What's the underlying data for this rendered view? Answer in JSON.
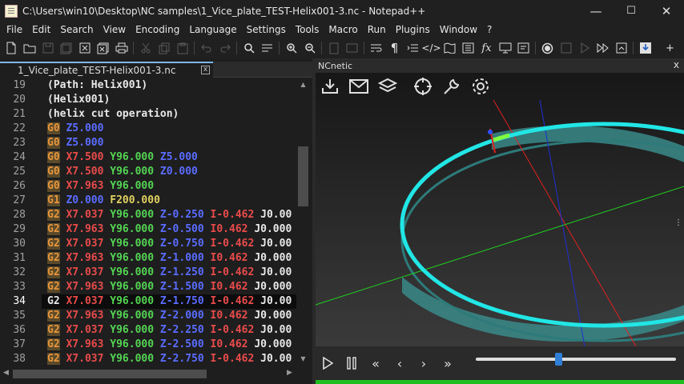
{
  "window": {
    "title": "C:\\Users\\win10\\Desktop\\NC samples\\1_Vice_plate_TEST-Helix001-3.nc - Notepad++",
    "minimize": "—",
    "maximize": "☐",
    "close": "✕"
  },
  "menu": [
    "File",
    "Edit",
    "Search",
    "View",
    "Encoding",
    "Language",
    "Settings",
    "Tools",
    "Macro",
    "Run",
    "Plugins",
    "Window",
    "?"
  ],
  "toolbar_more": "+",
  "editor": {
    "tab_label": "1_Vice_plate_TEST-Helix001-3.nc",
    "tab_close": "x",
    "current_line": 34,
    "lines": [
      {
        "n": "19",
        "tokens": [
          {
            "t": "(Path: Helix001)",
            "c": "c-cmt"
          }
        ]
      },
      {
        "n": "20",
        "tokens": [
          {
            "t": "(Helix001)",
            "c": "c-cmt"
          }
        ]
      },
      {
        "n": "21",
        "tokens": [
          {
            "t": "(helix cut operation)",
            "c": "c-cmt"
          }
        ]
      },
      {
        "n": "22",
        "tokens": [
          {
            "t": "G0",
            "c": "c-g"
          },
          {
            "t": " "
          },
          {
            "t": "Z5.000",
            "c": "c-z"
          }
        ]
      },
      {
        "n": "23",
        "tokens": [
          {
            "t": "G0",
            "c": "c-g"
          },
          {
            "t": " "
          },
          {
            "t": "Z5.000",
            "c": "c-z"
          }
        ]
      },
      {
        "n": "24",
        "tokens": [
          {
            "t": "G0",
            "c": "c-g"
          },
          {
            "t": " "
          },
          {
            "t": "X7.500",
            "c": "c-x"
          },
          {
            "t": " "
          },
          {
            "t": "Y96.000",
            "c": "c-y"
          },
          {
            "t": " "
          },
          {
            "t": "Z5.000",
            "c": "c-z"
          }
        ]
      },
      {
        "n": "25",
        "tokens": [
          {
            "t": "G0",
            "c": "c-g"
          },
          {
            "t": " "
          },
          {
            "t": "X7.500",
            "c": "c-x"
          },
          {
            "t": " "
          },
          {
            "t": "Y96.000",
            "c": "c-y"
          },
          {
            "t": " "
          },
          {
            "t": "Z0.000",
            "c": "c-z"
          }
        ]
      },
      {
        "n": "26",
        "tokens": [
          {
            "t": "G0",
            "c": "c-g"
          },
          {
            "t": " "
          },
          {
            "t": "X7.963",
            "c": "c-x"
          },
          {
            "t": " "
          },
          {
            "t": "Y96.000",
            "c": "c-y"
          }
        ]
      },
      {
        "n": "27",
        "tokens": [
          {
            "t": "G1",
            "c": "c-g"
          },
          {
            "t": " "
          },
          {
            "t": "Z0.000",
            "c": "c-z"
          },
          {
            "t": " "
          },
          {
            "t": "F200.000",
            "c": "c-f"
          }
        ]
      },
      {
        "n": "28",
        "tokens": [
          {
            "t": "G2",
            "c": "c-g"
          },
          {
            "t": " "
          },
          {
            "t": "X7.037",
            "c": "c-x"
          },
          {
            "t": " "
          },
          {
            "t": "Y96.000",
            "c": "c-y"
          },
          {
            "t": " "
          },
          {
            "t": "Z-0.250",
            "c": "c-z"
          },
          {
            "t": " "
          },
          {
            "t": "I-0.462",
            "c": "c-i"
          },
          {
            "t": " "
          },
          {
            "t": "J0.00",
            "c": "c-j"
          }
        ]
      },
      {
        "n": "29",
        "tokens": [
          {
            "t": "G2",
            "c": "c-g"
          },
          {
            "t": " "
          },
          {
            "t": "X7.963",
            "c": "c-x"
          },
          {
            "t": " "
          },
          {
            "t": "Y96.000",
            "c": "c-y"
          },
          {
            "t": " "
          },
          {
            "t": "Z-0.500",
            "c": "c-z"
          },
          {
            "t": " "
          },
          {
            "t": "I0.462",
            "c": "c-i"
          },
          {
            "t": " "
          },
          {
            "t": "J0.000",
            "c": "c-j"
          }
        ]
      },
      {
        "n": "30",
        "tokens": [
          {
            "t": "G2",
            "c": "c-g"
          },
          {
            "t": " "
          },
          {
            "t": "X7.037",
            "c": "c-x"
          },
          {
            "t": " "
          },
          {
            "t": "Y96.000",
            "c": "c-y"
          },
          {
            "t": " "
          },
          {
            "t": "Z-0.750",
            "c": "c-z"
          },
          {
            "t": " "
          },
          {
            "t": "I-0.462",
            "c": "c-i"
          },
          {
            "t": " "
          },
          {
            "t": "J0.00",
            "c": "c-j"
          }
        ]
      },
      {
        "n": "31",
        "tokens": [
          {
            "t": "G2",
            "c": "c-g"
          },
          {
            "t": " "
          },
          {
            "t": "X7.963",
            "c": "c-x"
          },
          {
            "t": " "
          },
          {
            "t": "Y96.000",
            "c": "c-y"
          },
          {
            "t": " "
          },
          {
            "t": "Z-1.000",
            "c": "c-z"
          },
          {
            "t": " "
          },
          {
            "t": "I0.462",
            "c": "c-i"
          },
          {
            "t": " "
          },
          {
            "t": "J0.000",
            "c": "c-j"
          }
        ]
      },
      {
        "n": "32",
        "tokens": [
          {
            "t": "G2",
            "c": "c-g"
          },
          {
            "t": " "
          },
          {
            "t": "X7.037",
            "c": "c-x"
          },
          {
            "t": " "
          },
          {
            "t": "Y96.000",
            "c": "c-y"
          },
          {
            "t": " "
          },
          {
            "t": "Z-1.250",
            "c": "c-z"
          },
          {
            "t": " "
          },
          {
            "t": "I-0.462",
            "c": "c-i"
          },
          {
            "t": " "
          },
          {
            "t": "J0.00",
            "c": "c-j"
          }
        ]
      },
      {
        "n": "33",
        "tokens": [
          {
            "t": "G2",
            "c": "c-g"
          },
          {
            "t": " "
          },
          {
            "t": "X7.963",
            "c": "c-x"
          },
          {
            "t": " "
          },
          {
            "t": "Y96.000",
            "c": "c-y"
          },
          {
            "t": " "
          },
          {
            "t": "Z-1.500",
            "c": "c-z"
          },
          {
            "t": " "
          },
          {
            "t": "I0.462",
            "c": "c-i"
          },
          {
            "t": " "
          },
          {
            "t": "J0.000",
            "c": "c-j"
          }
        ]
      },
      {
        "n": "34",
        "tokens": [
          {
            "t": "G2",
            "c": "c-j"
          },
          {
            "t": " "
          },
          {
            "t": "X7.037",
            "c": "c-x"
          },
          {
            "t": " "
          },
          {
            "t": "Y96.000",
            "c": "c-y"
          },
          {
            "t": " "
          },
          {
            "t": "Z-1.750",
            "c": "c-z"
          },
          {
            "t": " "
          },
          {
            "t": "I-0.462",
            "c": "c-i"
          },
          {
            "t": " "
          },
          {
            "t": "J0.00",
            "c": "c-j"
          }
        ]
      },
      {
        "n": "35",
        "tokens": [
          {
            "t": "G2",
            "c": "c-g"
          },
          {
            "t": " "
          },
          {
            "t": "X7.963",
            "c": "c-x"
          },
          {
            "t": " "
          },
          {
            "t": "Y96.000",
            "c": "c-y"
          },
          {
            "t": " "
          },
          {
            "t": "Z-2.000",
            "c": "c-z"
          },
          {
            "t": " "
          },
          {
            "t": "I0.462",
            "c": "c-i"
          },
          {
            "t": " "
          },
          {
            "t": "J0.000",
            "c": "c-j"
          }
        ]
      },
      {
        "n": "36",
        "tokens": [
          {
            "t": "G2",
            "c": "c-g"
          },
          {
            "t": " "
          },
          {
            "t": "X7.037",
            "c": "c-x"
          },
          {
            "t": " "
          },
          {
            "t": "Y96.000",
            "c": "c-y"
          },
          {
            "t": " "
          },
          {
            "t": "Z-2.250",
            "c": "c-z"
          },
          {
            "t": " "
          },
          {
            "t": "I-0.462",
            "c": "c-i"
          },
          {
            "t": " "
          },
          {
            "t": "J0.00",
            "c": "c-j"
          }
        ]
      },
      {
        "n": "37",
        "tokens": [
          {
            "t": "G2",
            "c": "c-g"
          },
          {
            "t": " "
          },
          {
            "t": "X7.963",
            "c": "c-x"
          },
          {
            "t": " "
          },
          {
            "t": "Y96.000",
            "c": "c-y"
          },
          {
            "t": " "
          },
          {
            "t": "Z-2.500",
            "c": "c-z"
          },
          {
            "t": " "
          },
          {
            "t": "I0.462",
            "c": "c-i"
          },
          {
            "t": " "
          },
          {
            "t": "J0.000",
            "c": "c-j"
          }
        ]
      },
      {
        "n": "38",
        "tokens": [
          {
            "t": "G2",
            "c": "c-g"
          },
          {
            "t": " "
          },
          {
            "t": "X7.037",
            "c": "c-x"
          },
          {
            "t": " "
          },
          {
            "t": "Y96.000",
            "c": "c-y"
          },
          {
            "t": " "
          },
          {
            "t": "Z-2.750",
            "c": "c-z"
          },
          {
            "t": " "
          },
          {
            "t": "I-0.462",
            "c": "c-i"
          },
          {
            "t": " "
          },
          {
            "t": "J0.00",
            "c": "c-j"
          }
        ]
      }
    ]
  },
  "panel": {
    "title": "NCnetic",
    "close": "x",
    "timeline_value": 0.41,
    "colors": {
      "toolpath": "#22e6e6",
      "wall": "#3a8a8a",
      "x_axis": "#e02020",
      "y_axis": "#20d020",
      "z_axis": "#2030d0",
      "progress": "#1fbe1f"
    }
  }
}
